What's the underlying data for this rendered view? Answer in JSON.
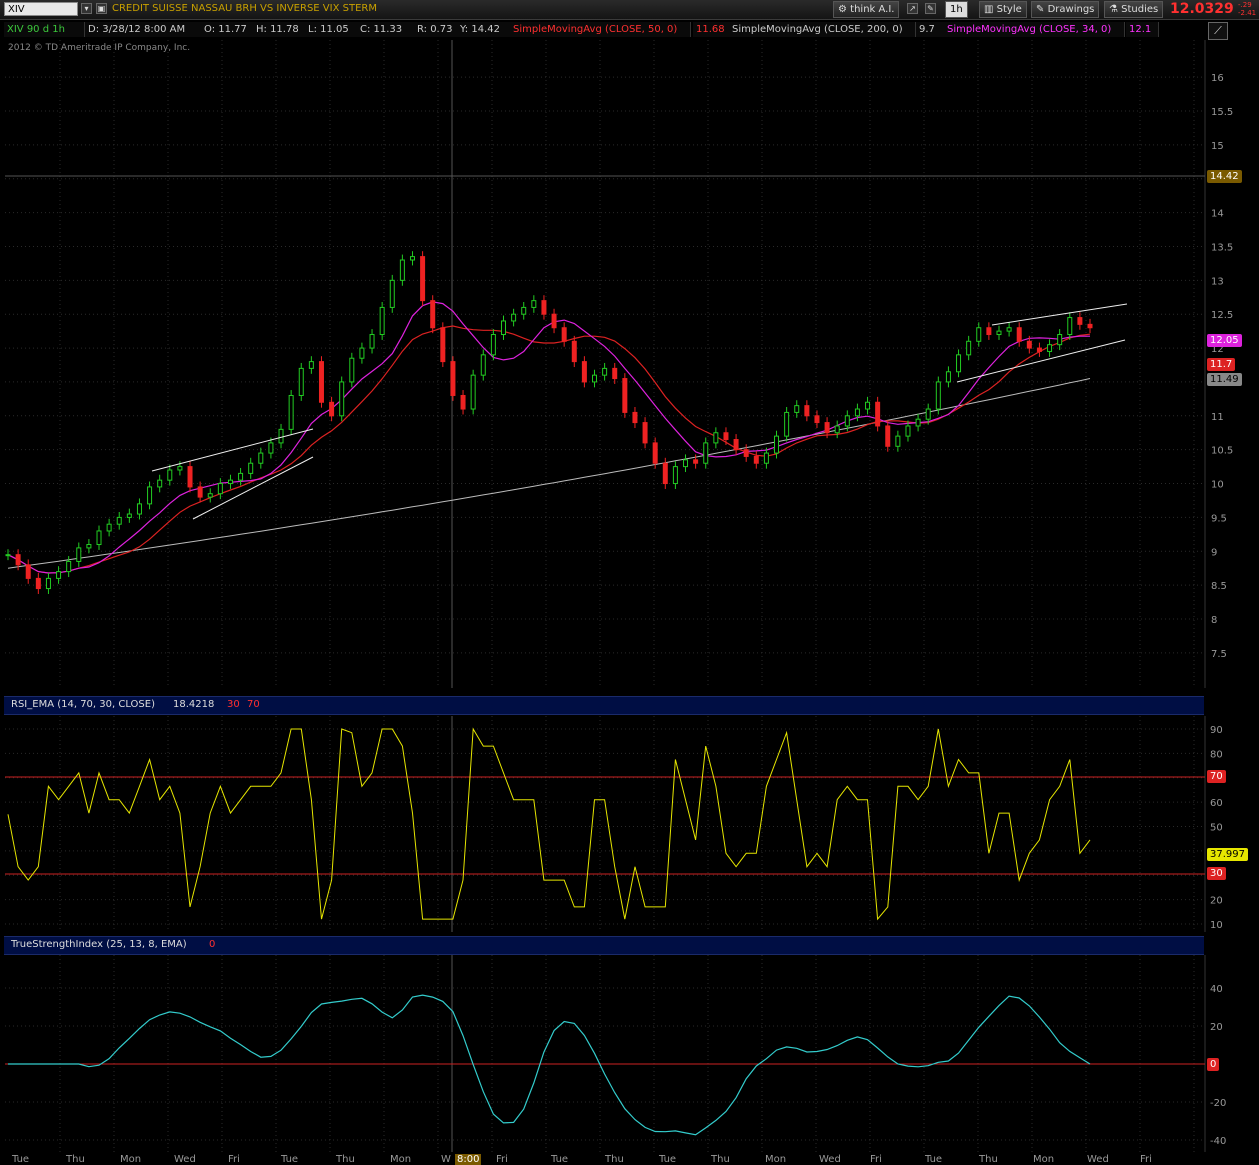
{
  "toolbar": {
    "symbol": "XIV",
    "company_name": "CREDIT SUISSE NASSAU BRH VS INVERSE VIX STERM",
    "think_label": "think A.I.",
    "timeframe_label": "1h",
    "style_label": "Style",
    "drawings_label": "Drawings",
    "studies_label": "Studies",
    "last_price": "12.0329",
    "change_top": "-.29",
    "change_bottom": "-2.41",
    "icons": [
      "dropdown-icon",
      "expand-icon",
      "settings-icon",
      "style-icon",
      "pencil-icon",
      "studies-icon",
      "link-icon"
    ]
  },
  "header": {
    "chart_id": "XIV 90 d 1h",
    "date": "D: 3/28/12 8:00 AM",
    "open": "O: 11.77",
    "high": "H: 11.78",
    "low": "L: 11.05",
    "close": "C: 11.33",
    "range": "R: 0.73",
    "y": "Y: 14.42",
    "sma50_label": "SimpleMovingAvg (CLOSE, 50, 0)",
    "sma50_value": "11.68",
    "sma200_label": "SimpleMovingAvg (CLOSE, 200, 0)",
    "sma200_value": "9.7",
    "sma34_label": "SimpleMovingAvg (CLOSE, 34, 0)",
    "sma34_value": "12.1",
    "copyright": "2012 © TD Ameritrade IP Company, Inc."
  },
  "price_axis": {
    "ticks": [
      "16",
      "15.5",
      "15",
      "14.5",
      "14",
      "13.5",
      "13",
      "12.5",
      "12",
      "11.5",
      "11",
      "10.5",
      "10",
      "9.5",
      "9",
      "8.5",
      "8",
      "7.5"
    ],
    "crosshair_tag": "14.42",
    "sma34_tag": "12.05",
    "sma50_tag": "11.7",
    "sma200_tag": "11.49"
  },
  "rsi": {
    "label": "RSI_EMA (14, 70, 30, CLOSE)",
    "value": "18.4218",
    "oversold": "30",
    "overbought": "70",
    "ticks": [
      "90",
      "80",
      "70",
      "60",
      "50",
      "40",
      "30",
      "20",
      "10"
    ],
    "current_tag": "37.997",
    "ob_tag": "70",
    "os_tag": "30"
  },
  "tsi": {
    "label": "TrueStrengthIndex (25, 13, 8, EMA)",
    "zero": "0",
    "ticks": [
      "40",
      "20",
      "0",
      "-20",
      "-40"
    ],
    "zero_tag": "0"
  },
  "x_axis": {
    "labels": [
      "Tue",
      "Thu",
      "Mon",
      "Wed",
      "Fri",
      "Tue",
      "Thu",
      "Mon",
      "W",
      "8:00",
      "Fri",
      "Tue",
      "Thu",
      "Tue",
      "Thu",
      "Mon",
      "Wed",
      "Fri",
      "Tue",
      "Thu",
      "Mon",
      "Wed",
      "Fri"
    ]
  },
  "colors": {
    "up": "#22cc22",
    "down": "#ee2222",
    "sma34": "#dd22dd",
    "sma50": "#dd2222",
    "sma200": "#bbbbbb",
    "rsi": "#e6e600",
    "tsi": "#33cccc",
    "levels": "#cc2222"
  },
  "chart_data": {
    "type": "candlestick",
    "title": "XIV 90 d 1h",
    "ylim": [
      7.1,
      16.4
    ],
    "closes": [
      8.95,
      8.8,
      8.6,
      8.45,
      8.6,
      8.7,
      8.85,
      9.05,
      9.1,
      9.3,
      9.4,
      9.5,
      9.55,
      9.7,
      9.95,
      10.05,
      10.2,
      10.25,
      9.95,
      9.8,
      9.85,
      10.0,
      10.05,
      10.15,
      10.3,
      10.45,
      10.6,
      10.8,
      11.3,
      11.7,
      11.8,
      11.2,
      11.0,
      11.5,
      11.85,
      12.0,
      12.2,
      12.6,
      13.0,
      13.3,
      13.35,
      12.7,
      12.3,
      11.8,
      11.3,
      11.1,
      11.6,
      11.9,
      12.2,
      12.4,
      12.5,
      12.6,
      12.7,
      12.5,
      12.3,
      12.1,
      11.8,
      11.5,
      11.6,
      11.7,
      11.55,
      11.05,
      10.9,
      10.6,
      10.3,
      10.0,
      10.25,
      10.35,
      10.3,
      10.6,
      10.75,
      10.65,
      10.5,
      10.4,
      10.3,
      10.45,
      10.7,
      11.05,
      11.15,
      11.0,
      10.9,
      10.75,
      10.85,
      11.0,
      11.1,
      11.2,
      10.85,
      10.55,
      10.7,
      10.85,
      10.95,
      11.1,
      11.5,
      11.65,
      11.9,
      12.1,
      12.3,
      12.2,
      12.25,
      12.3,
      12.1,
      12.0,
      11.95,
      12.05,
      12.2,
      12.45,
      12.35,
      12.3
    ]
  }
}
